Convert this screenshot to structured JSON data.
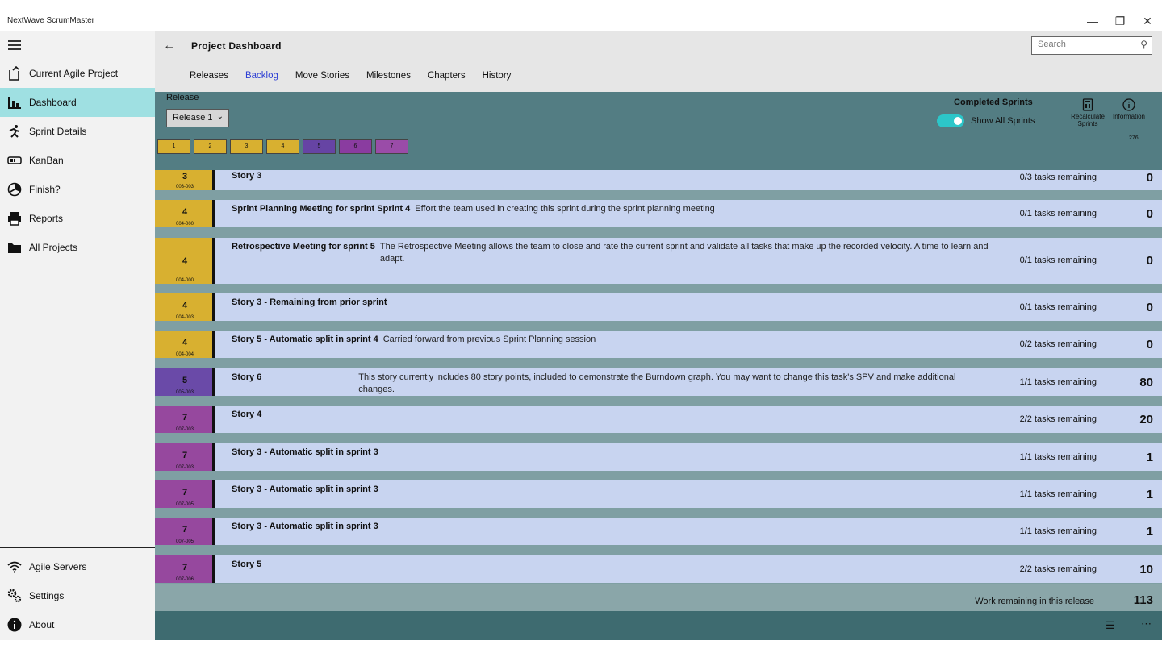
{
  "window": {
    "title": "NextWave ScrumMaster"
  },
  "sidebar": {
    "items": [
      {
        "label": "Current Agile Project",
        "icon": "new-document-icon"
      },
      {
        "label": "Dashboard",
        "icon": "dashboard-icon",
        "active": true
      },
      {
        "label": "Sprint Details",
        "icon": "runner-icon"
      },
      {
        "label": "KanBan",
        "icon": "kanban-icon"
      },
      {
        "label": "Finish?",
        "icon": "finish-pie-icon"
      },
      {
        "label": "Reports",
        "icon": "printer-icon"
      },
      {
        "label": "All Projects",
        "icon": "folder-icon"
      }
    ],
    "bottom_items": [
      {
        "label": "Agile Servers",
        "icon": "wifi-icon"
      },
      {
        "label": "Settings",
        "icon": "gears-icon"
      },
      {
        "label": "About",
        "icon": "info-icon"
      }
    ]
  },
  "header": {
    "title": "Project Dashboard",
    "search_placeholder": "Search",
    "tabs": [
      {
        "label": "Releases"
      },
      {
        "label": "Backlog",
        "selected": true
      },
      {
        "label": "Move Stories"
      },
      {
        "label": "Milestones"
      },
      {
        "label": "Chapters"
      },
      {
        "label": "History"
      }
    ]
  },
  "toolbar": {
    "release_label": "Release",
    "release_value": "Release 1",
    "sprints": [
      {
        "label": "1",
        "color": "#d8b030"
      },
      {
        "label": "2",
        "color": "#d8b030"
      },
      {
        "label": "3",
        "color": "#d8b030"
      },
      {
        "label": "4",
        "color": "#d8b030"
      },
      {
        "label": "5",
        "color": "#6644a4"
      },
      {
        "label": "6",
        "color": "#8a3ca0"
      },
      {
        "label": "7",
        "color": "#9a4ca8"
      }
    ],
    "completed_sprints_label": "Completed Sprints",
    "show_all_label": "Show All Sprints",
    "recalc_label_1": "Recalculate",
    "recalc_label_2": "Sprints",
    "info_label": "Information",
    "info_count": "276"
  },
  "colors": {
    "gold": "#d8b030",
    "indigo": "#6a4aa8",
    "purple": "#96489e",
    "row_bg": "#c8d4f0",
    "accent": "#2cc6c9"
  },
  "stories": [
    {
      "sprint": "3",
      "code": "003-003",
      "name": "Story 3",
      "desc": "",
      "tasks": "0/3 tasks remaining",
      "points": "0",
      "color": "#d8b030"
    },
    {
      "sprint": "4",
      "code": "004-000",
      "name": "Sprint Planning Meeting for sprint Sprint 4",
      "desc": "Effort the team used in creating this sprint during the sprint planning meeting",
      "tasks": "0/1 tasks remaining",
      "points": "0",
      "color": "#d8b030"
    },
    {
      "sprint": "4",
      "code": "004-000",
      "name": "Retrospective Meeting for sprint 5",
      "desc": "The Retrospective Meeting allows the team to close and rate the current sprint and validate all tasks that make up the recorded velocity.   A time to learn and adapt.",
      "tasks": "0/1 tasks remaining",
      "points": "0",
      "color": "#d8b030"
    },
    {
      "sprint": "4",
      "code": "004-003",
      "name": "Story 3 - Remaining from prior sprint",
      "desc": "",
      "tasks": "0/1 tasks remaining",
      "points": "0",
      "color": "#d8b030"
    },
    {
      "sprint": "4",
      "code": "004-004",
      "name": "Story 5 - Automatic split in sprint 4",
      "desc": "Carried forward from previous Sprint Planning session",
      "tasks": "0/2 tasks remaining",
      "points": "0",
      "color": "#d8b030"
    },
    {
      "sprint": "5",
      "code": "005-003",
      "name": "Story 6",
      "desc": "This story currently includes 80 story points, included to demonstrate the Burndown graph.  You may want to change this task's SPV and make additional changes.",
      "tasks": "1/1 tasks remaining",
      "points": "80",
      "color": "#6a4aa8"
    },
    {
      "sprint": "7",
      "code": "007-003",
      "name": "Story 4",
      "desc": "",
      "tasks": "2/2 tasks remaining",
      "points": "20",
      "color": "#96489e"
    },
    {
      "sprint": "7",
      "code": "007-003",
      "name": "Story 3 - Automatic split in sprint 3",
      "desc": "",
      "tasks": "1/1 tasks remaining",
      "points": "1",
      "color": "#96489e"
    },
    {
      "sprint": "7",
      "code": "007-005",
      "name": "Story 3 - Automatic split in sprint 3",
      "desc": "",
      "tasks": "1/1 tasks remaining",
      "points": "1",
      "color": "#96489e"
    },
    {
      "sprint": "7",
      "code": "007-005",
      "name": "Story 3 - Automatic split in sprint 3",
      "desc": "",
      "tasks": "1/1 tasks remaining",
      "points": "1",
      "color": "#96489e"
    },
    {
      "sprint": "7",
      "code": "007-006",
      "name": "Story 5",
      "desc": "",
      "tasks": "2/2 tasks remaining",
      "points": "10",
      "color": "#96489e"
    }
  ],
  "summary": {
    "label": "Work remaining in this release",
    "value": "113"
  }
}
